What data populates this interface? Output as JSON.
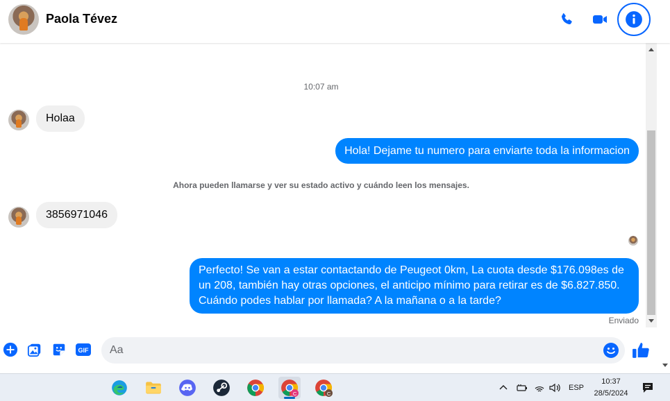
{
  "header": {
    "contact_name": "Paola Tévez"
  },
  "chat": {
    "timestamp": "10:07 am",
    "messages": [
      {
        "direction": "in",
        "text": "Holaa"
      },
      {
        "direction": "out",
        "text": "Hola! Dejame tu numero para enviarte toda la informacion"
      },
      {
        "direction": "in",
        "text": "3856971046"
      },
      {
        "direction": "out",
        "text": "Perfecto!  Se van a estar contactando de Peugeot 0km, La cuota desde $176.098es de un 208, también hay otras opciones, el anticipo mínimo para retirar es de $6.827.850. Cuándo podes hablar por llamada? A la mañana o a la tarde?"
      }
    ],
    "notice": "Ahora pueden llamarse y ver su estado activo y cuándo leen los mensajes.",
    "sent_status": "Enviado"
  },
  "composer": {
    "placeholder": "Aa",
    "value": ""
  },
  "taskbar": {
    "language": "ESP",
    "time": "10:37",
    "date": "28/5/2024",
    "apps": [
      "edge-icon",
      "file-explorer-icon",
      "discord-icon",
      "steam-icon",
      "chrome-icon",
      "chrome-profile-c-icon",
      "chrome-profile-c-icon"
    ]
  },
  "colors": {
    "accent": "#0866ff",
    "outgoing_bubble": "#0084ff",
    "incoming_bubble": "#f0f0f0"
  }
}
